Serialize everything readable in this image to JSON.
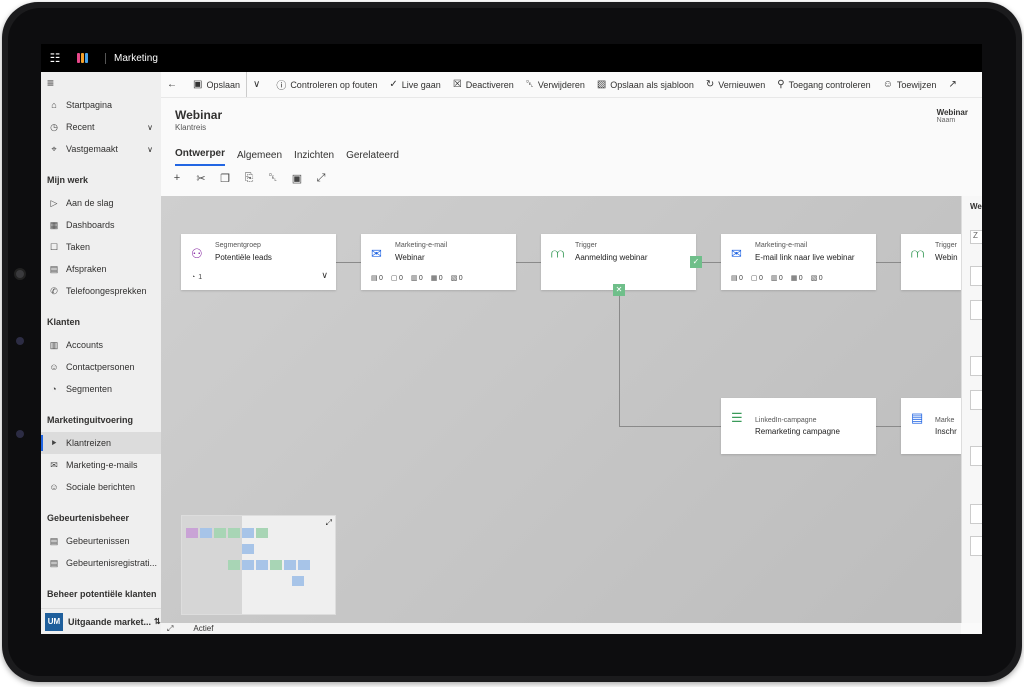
{
  "topbar": {
    "app_name": "Marketing"
  },
  "sidebar": {
    "home": "Startpagina",
    "recent": "Recent",
    "pinned": "Vastgemaakt",
    "sections": [
      {
        "title": "Mijn werk",
        "items": [
          "Aan de slag",
          "Dashboards",
          "Taken",
          "Afspraken",
          "Telefoongesprekken"
        ]
      },
      {
        "title": "Klanten",
        "items": [
          "Accounts",
          "Contactpersonen",
          "Segmenten"
        ]
      },
      {
        "title": "Marketinguitvoering",
        "items": [
          "Klantreizen",
          "Marketing-e-mails",
          "Sociale berichten"
        ]
      },
      {
        "title": "Gebeurtenisbeheer",
        "items": [
          "Gebeurtenissen",
          "Gebeurtenisregistrati..."
        ]
      },
      {
        "title": "Beheer potentiële klanten",
        "items": []
      }
    ],
    "area": {
      "badge": "UM",
      "label": "Uitgaande market..."
    }
  },
  "commands": {
    "save": "Opslaan",
    "check": "Controleren op fouten",
    "golive": "Live gaan",
    "deactivate": "Deactiveren",
    "delete": "Verwijderen",
    "template": "Opslaan als sjabloon",
    "refresh": "Vernieuwen",
    "access": "Toegang controleren",
    "assign": "Toewijzen"
  },
  "header": {
    "title": "Webinar",
    "subtitle": "Klantreis",
    "field_value": "Webinar",
    "field_label": "Naam"
  },
  "tabs": [
    "Ontwerper",
    "Algemeen",
    "Inzichten",
    "Gerelateerd"
  ],
  "tiles": [
    {
      "type": "Segmentgroep",
      "name": "Potentiële leads",
      "count": "1"
    },
    {
      "type": "Marketing-e-mail",
      "name": "Webinar",
      "metrics": [
        "0",
        "0",
        "0",
        "0",
        "0"
      ]
    },
    {
      "type": "Trigger",
      "name": "Aanmelding webinar"
    },
    {
      "type": "Marketing-e-mail",
      "name": "E-mail link naar live webinar",
      "metrics": [
        "0",
        "0",
        "0",
        "0",
        "0"
      ]
    },
    {
      "type": "Trigger",
      "name": "Webin"
    },
    {
      "type": "LinkedIn-campagne",
      "name": "Remarketing campagne"
    },
    {
      "type": "Marke",
      "name": "Inschr"
    }
  ],
  "status": {
    "label": "Actief"
  },
  "right_panel": {
    "header": "We",
    "search": "Z"
  },
  "colors": {
    "accent": "#2266e3",
    "trigger": "#3a9b5a",
    "segment": "#8a2da5"
  }
}
